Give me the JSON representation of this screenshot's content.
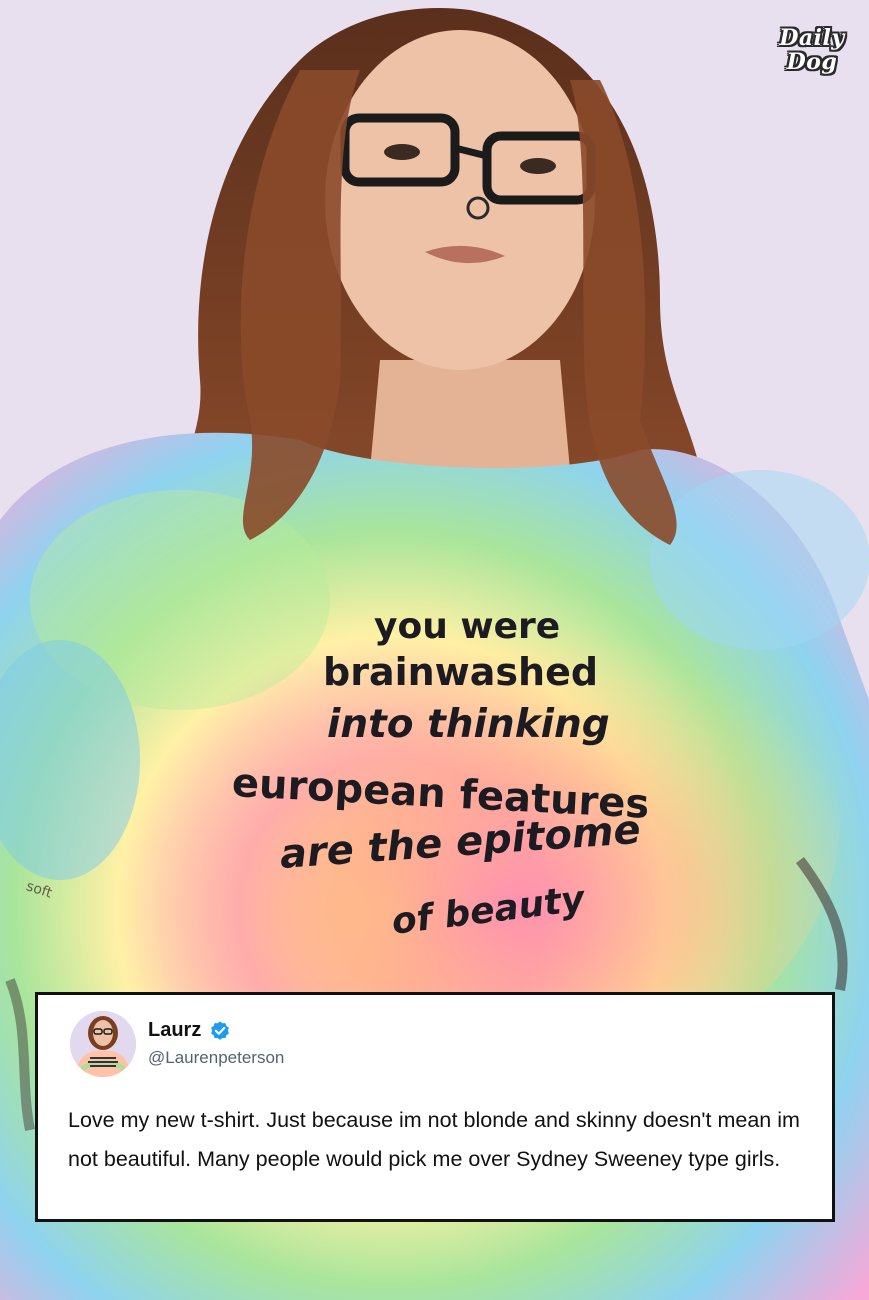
{
  "logo": {
    "line1": "Daily",
    "line2": "Dog"
  },
  "photo": {
    "shirt_lines": [
      "you were",
      "brainwashed",
      "into thinking",
      "european features",
      "are the epitome",
      "of beauty"
    ],
    "tattoo_text": "soft"
  },
  "tweet": {
    "name": "Laurz",
    "handle": "@Laurenpeterson",
    "text": "Love my new t-shirt. Just because im not blonde and skinny doesn't mean im not beautiful. Many people would pick me over Sydney Sweeney type girls.",
    "verified_icon": "verified-badge-icon",
    "verified_color": "#1d9bf0"
  }
}
